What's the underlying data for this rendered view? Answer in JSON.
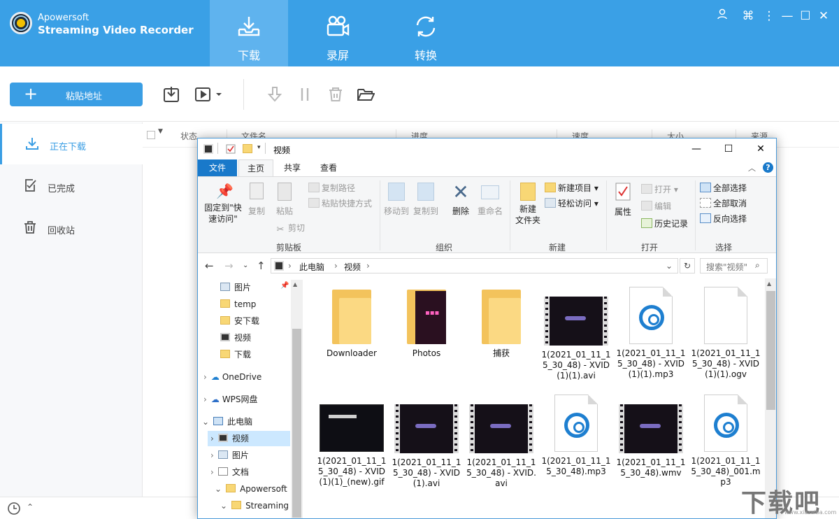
{
  "app": {
    "brand_line1": "Apowersoft",
    "brand_line2": "Streaming Video Recorder",
    "main_tabs": [
      {
        "label": "下载",
        "icon": "download-tray-icon"
      },
      {
        "label": "录屏",
        "icon": "video-camera-icon"
      },
      {
        "label": "转换",
        "icon": "convert-arrows-icon"
      }
    ],
    "window_controls": [
      "user-icon",
      "command-icon",
      "more-icon",
      "minimize-icon",
      "maximize-icon",
      "close-icon"
    ],
    "colors": {
      "primary": "#3aa0e6",
      "accent": "#3a9ee4",
      "active_tab": "#5fb3ee"
    }
  },
  "toolbar": {
    "paste_label": "粘贴地址",
    "icons": [
      "download-add-icon",
      "video-menu-icon",
      "dropdown-arrow-icon",
      "start-download-icon",
      "pause-icon",
      "delete-icon",
      "open-folder-icon"
    ]
  },
  "sidebar": {
    "items": [
      {
        "label": "正在下载",
        "icon": "downloading-icon"
      },
      {
        "label": "已完成",
        "icon": "completed-icon"
      },
      {
        "label": "回收站",
        "icon": "recycle-bin-icon"
      }
    ]
  },
  "table": {
    "columns": [
      "状态",
      "文件名",
      "进度",
      "速度",
      "大小",
      "来源"
    ]
  },
  "explorer": {
    "title": "视频",
    "ribbon_tabs": [
      "文件",
      "主页",
      "共享",
      "查看"
    ],
    "groups": {
      "clipboard": {
        "label": "剪贴板",
        "pin": "固定到\"快速访问\"",
        "copy": "复制",
        "paste": "粘贴",
        "copy_path": "复制路径",
        "paste_shortcut": "粘贴快捷方式",
        "cut": "剪切"
      },
      "organize": {
        "label": "组织",
        "move_to": "移动到",
        "copy_to": "复制到",
        "delete": "删除",
        "rename": "重命名"
      },
      "new": {
        "label": "新建",
        "new_folder": "新建\n文件夹",
        "new_item": "新建项目",
        "easy_access": "轻松访问"
      },
      "open": {
        "label": "打开",
        "properties": "属性",
        "open": "打开",
        "edit": "编辑",
        "history": "历史记录"
      },
      "select": {
        "label": "选择",
        "select_all": "全部选择",
        "select_none": "全部取消",
        "invert": "反向选择"
      }
    },
    "address": {
      "part1": "此电脑",
      "part2": "视频",
      "search_placeholder": "搜索\"视频\""
    },
    "nav": [
      {
        "label": "图片",
        "type": "image"
      },
      {
        "label": "temp",
        "type": "folder"
      },
      {
        "label": "安下载",
        "type": "folder"
      },
      {
        "label": "视频",
        "type": "video"
      },
      {
        "label": "下载",
        "type": "folder"
      },
      {
        "label": "OneDrive",
        "type": "cloud"
      },
      {
        "label": "WPS网盘",
        "type": "cloud"
      },
      {
        "label": "此电脑",
        "type": "pc"
      },
      {
        "label": "视频",
        "type": "video"
      },
      {
        "label": "图片",
        "type": "image"
      },
      {
        "label": "文档",
        "type": "doc"
      },
      {
        "label": "Apowersoft",
        "type": "folder"
      },
      {
        "label": "Streaming",
        "type": "folder"
      }
    ],
    "files_row1": [
      {
        "name": "Downloader",
        "kind": "folder"
      },
      {
        "name": "Photos",
        "kind": "photos"
      },
      {
        "name": "捕获",
        "kind": "folder"
      },
      {
        "name": "1(2021_01_11_15_30_48) - XVID(1)(1).avi",
        "kind": "video"
      },
      {
        "name": "1(2021_01_11_15_30_48) - XVID(1)(1).mp3",
        "kind": "audio"
      },
      {
        "name": "1(2021_01_11_15_30_48) - XVID(1)(1).ogv",
        "kind": "blank"
      }
    ],
    "files_row2": [
      {
        "name": "1(2021_01_11_15_30_48) - XVID(1)(1)_(new).gif",
        "kind": "gif"
      },
      {
        "name": "1(2021_01_11_15_30_48) - XVID(1).avi",
        "kind": "video"
      },
      {
        "name": "1(2021_01_11_15_30_48) - XVID.avi",
        "kind": "video"
      },
      {
        "name": "1(2021_01_11_15_30_48).mp3",
        "kind": "audio"
      },
      {
        "name": "1(2021_01_11_15_30_48).wmv",
        "kind": "video"
      },
      {
        "name": "1(2021_01_11_15_30_48)_001.mp3",
        "kind": "audio"
      }
    ]
  },
  "watermark": {
    "text": "下载吧",
    "sub": "www.xiazaiba.com"
  }
}
